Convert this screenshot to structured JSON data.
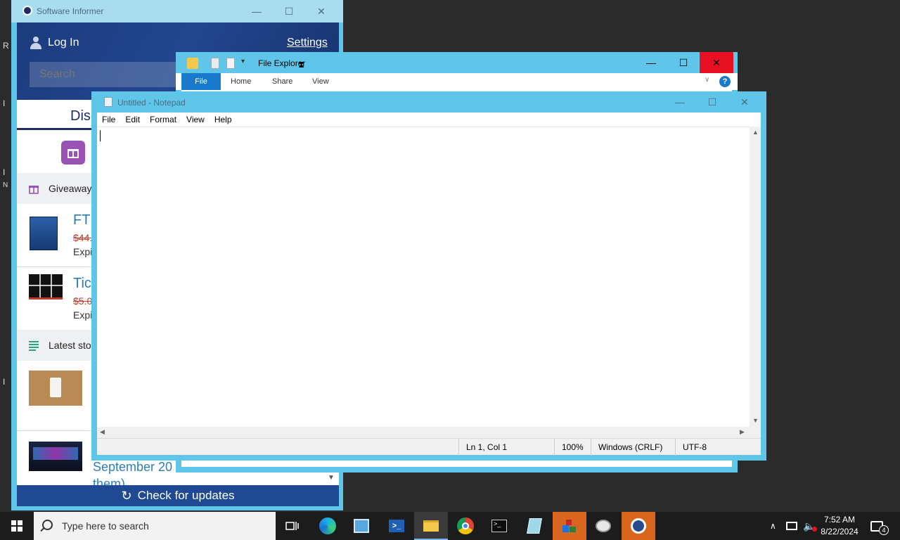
{
  "desktop": {
    "fragments": [
      "R",
      "I",
      "I",
      "N",
      "I"
    ]
  },
  "software_informer": {
    "title": "Software Informer",
    "login_label": "Log In",
    "settings_label": "Settings",
    "search_placeholder": "Search",
    "discover_label": "Disc",
    "giveaway_header": "Giveaway",
    "items": [
      {
        "name": "FTP",
        "price": "$44.",
        "expires": "Expi"
      },
      {
        "name": "Tic",
        "price": "$5.0",
        "expires": "Expi"
      }
    ],
    "latest_header": "Latest sto",
    "story_title": "September 20",
    "story_title_2": "them)",
    "check_updates": "Check for updates"
  },
  "file_explorer": {
    "title": "File Explorer",
    "tabs": [
      "File",
      "Home",
      "Share",
      "View"
    ],
    "help": "?"
  },
  "notepad": {
    "title": "Untitled - Notepad",
    "menu": [
      "File",
      "Edit",
      "Format",
      "View",
      "Help"
    ],
    "status": {
      "position": "Ln 1, Col 1",
      "zoom": "100%",
      "line_ending": "Windows (CRLF)",
      "encoding": "UTF-8"
    }
  },
  "taskbar": {
    "search_placeholder": "Type here to search",
    "time": "7:52 AM",
    "date": "8/22/2024",
    "notification_count": "4",
    "accent_color": "#d9661f"
  }
}
